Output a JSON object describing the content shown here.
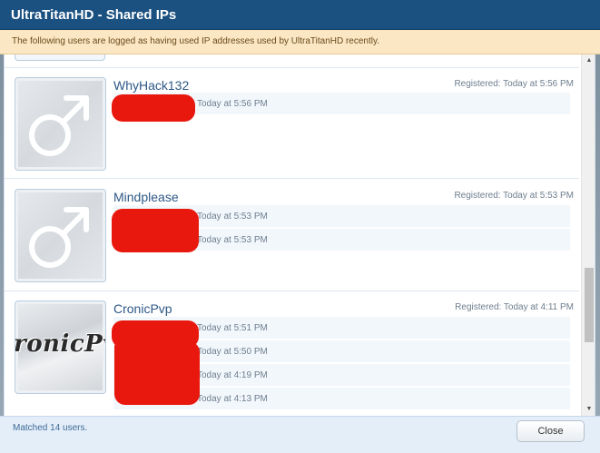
{
  "dialog": {
    "title": "UltraTitanHD - Shared IPs",
    "notice": "The following users are logged as having used IP addresses used by UltraTitanHD recently."
  },
  "users": [
    {
      "name": "WhyHack132",
      "registered": "Registered: Today at 5:56 PM",
      "ips": [
        {
          "time": "Today at 5:56 PM"
        }
      ],
      "avatar_icon": "male-symbol-icon"
    },
    {
      "name": "Mindplease",
      "registered": "Registered: Today at 5:53 PM",
      "ips": [
        {
          "time": "Today at 5:53 PM"
        },
        {
          "time": "Today at 5:53 PM"
        }
      ],
      "avatar_icon": "male-symbol-icon"
    },
    {
      "name": "CronicPvp",
      "registered": "Registered: Today at 4:11 PM",
      "ips": [
        {
          "time": "Today at 5:51 PM"
        },
        {
          "time": "Today at 5:50 PM"
        },
        {
          "time": "Today at 4:19 PM"
        },
        {
          "time": "Today at 4:13 PM"
        }
      ],
      "avatar_text": "ronicPv"
    }
  ],
  "footer": {
    "matched": "Matched 14 users.",
    "close_label": "Close"
  },
  "colors": {
    "header": "#1b5181",
    "notice_bg": "#fbe7c4",
    "username": "#2d5886",
    "redaction": "#e8180e"
  }
}
